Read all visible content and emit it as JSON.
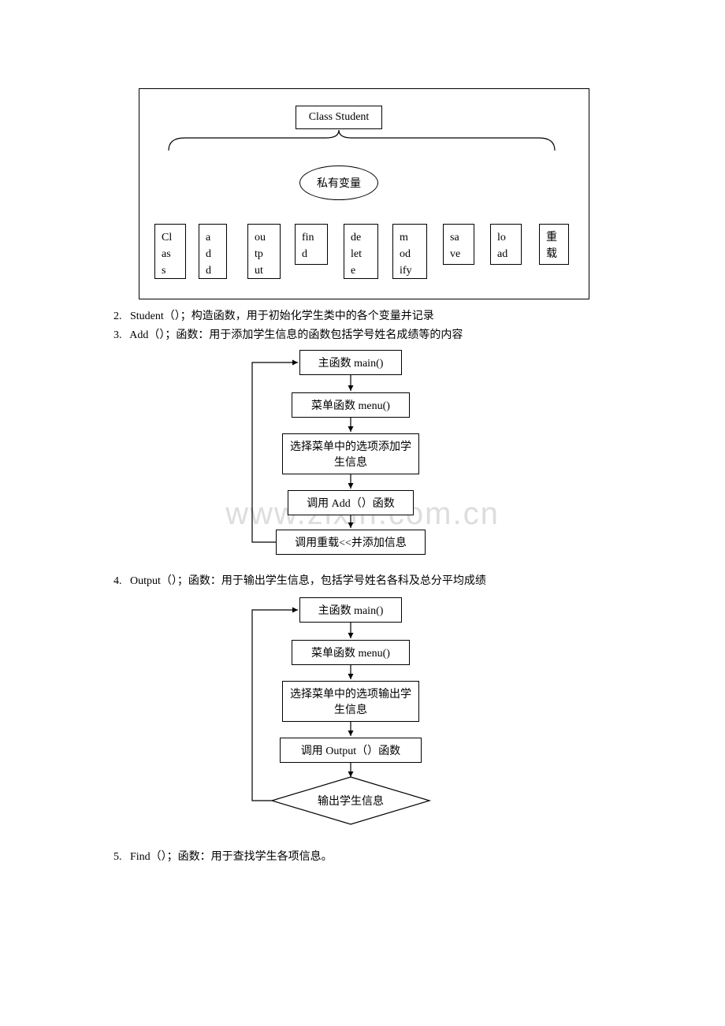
{
  "class_diagram": {
    "title": "Class Student",
    "private_label": "私有变量",
    "boxes": [
      {
        "t1": "Cl",
        "t2": "as",
        "t3": "s"
      },
      {
        "t1": "a",
        "t2": "d",
        "t3": "d"
      },
      {
        "t1": "ou",
        "t2": "tp",
        "t3": "ut"
      },
      {
        "t1": "fin",
        "t2": "d",
        "t3": ""
      },
      {
        "t1": "de",
        "t2": "let",
        "t3": "e"
      },
      {
        "t1": "m",
        "t2": "od",
        "t3": "ify"
      },
      {
        "t1": "sa",
        "t2": "ve",
        "t3": ""
      },
      {
        "t1": "lo",
        "t2": "ad",
        "t3": ""
      },
      {
        "t1": "重",
        "t2": "载",
        "t3": ""
      }
    ]
  },
  "items": {
    "i2": {
      "num": "2.",
      "text": "Student（）；构造函数，用于初始化学生类中的各个变量并记录"
    },
    "i3": {
      "num": "3.",
      "text": "Add（）；函数：用于添加学生信息的函数包括学号姓名成绩等的内容"
    },
    "i4": {
      "num": "4.",
      "text": "Output（）；函数：用于输出学生信息，包括学号姓名各科及总分平均成绩"
    },
    "i5": {
      "num": "5.",
      "text": "Find（）；函数：用于查找学生各项信息。"
    }
  },
  "flow_add": {
    "b1": "主函数 main()",
    "b2": "菜单函数 menu()",
    "b3": "选择菜单中的选项添加学生信息",
    "b4": "调用 Add（）函数",
    "b5": "调用重载<<并添加信息"
  },
  "flow_output": {
    "b1": "主函数 main()",
    "b2": "菜单函数 menu()",
    "b3": "选择菜单中的选项输出学生信息",
    "b4": "调用 Output（）函数",
    "b5": "输出学生信息"
  },
  "watermark": "www.zixin.com.cn"
}
